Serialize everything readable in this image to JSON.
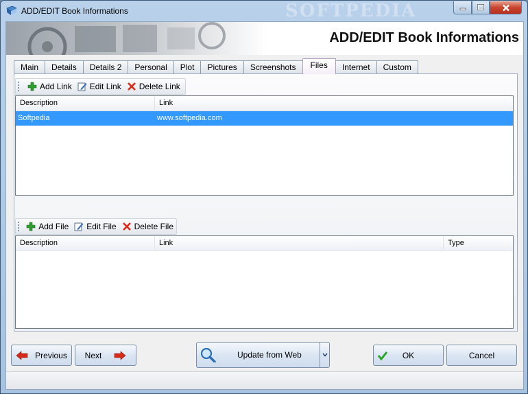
{
  "window": {
    "title": "ADD/EDIT Book Informations",
    "watermark": "SOFTPEDIA"
  },
  "banner": {
    "title": "ADD/EDIT Book Informations"
  },
  "tabs": [
    {
      "label": "Main"
    },
    {
      "label": "Details"
    },
    {
      "label": "Details 2"
    },
    {
      "label": "Personal"
    },
    {
      "label": "Plot"
    },
    {
      "label": "Pictures"
    },
    {
      "label": "Screenshots"
    },
    {
      "label": "Files",
      "active": true
    },
    {
      "label": "Internet"
    },
    {
      "label": "Custom"
    }
  ],
  "links_toolbar": {
    "add": "Add Link",
    "edit": "Edit Link",
    "delete": "Delete Link"
  },
  "links_table": {
    "columns": [
      "Description",
      "Link"
    ],
    "rows": [
      {
        "description": "Softpedia",
        "link": "www.softpedia.com"
      }
    ]
  },
  "files_toolbar": {
    "add": "Add File",
    "edit": "Edit File",
    "delete": "Delete File"
  },
  "files_table": {
    "columns": [
      "Description",
      "Link",
      "Type"
    ],
    "rows": []
  },
  "buttons": {
    "previous": "Previous",
    "next": "Next",
    "update": "Update from Web",
    "ok": "OK",
    "cancel": "Cancel"
  },
  "colors": {
    "selection": "#3399ff",
    "add_green": "#2e9e2e",
    "delete_red": "#d92b1b",
    "arrow_red": "#d42a1a",
    "ok_green": "#2aa52a"
  }
}
